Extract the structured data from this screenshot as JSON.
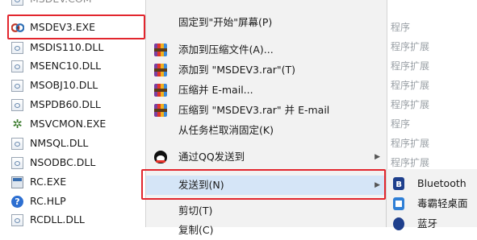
{
  "file_list": {
    "top_cut_label": "MSDEV.COM",
    "items": [
      {
        "label": "MSDEV3.EXE",
        "icon": "visual-studio-icon",
        "kind": "exe-vs"
      },
      {
        "label": "MSDIS110.DLL",
        "icon": "dll-icon",
        "kind": "dll"
      },
      {
        "label": "MSENC10.DLL",
        "icon": "dll-icon",
        "kind": "dll"
      },
      {
        "label": "MSOBJ10.DLL",
        "icon": "dll-icon",
        "kind": "dll"
      },
      {
        "label": "MSPDB60.DLL",
        "icon": "dll-icon",
        "kind": "dll"
      },
      {
        "label": "MSVCMON.EXE",
        "icon": "gear-icon",
        "kind": "gear"
      },
      {
        "label": "NMSQL.DLL",
        "icon": "dll-icon",
        "kind": "dll"
      },
      {
        "label": "NSODBC.DLL",
        "icon": "dll-icon",
        "kind": "dll"
      },
      {
        "label": "RC.EXE",
        "icon": "application-icon",
        "kind": "exe-app"
      },
      {
        "label": "RC.HLP",
        "icon": "help-icon",
        "kind": "help"
      },
      {
        "label": "RCDLL.DLL",
        "icon": "dll-icon",
        "kind": "dll"
      }
    ]
  },
  "background_column": {
    "items": [
      "程序",
      "程序扩展",
      "程序扩展",
      "程序扩展",
      "程序扩展",
      "程序",
      "程序扩展",
      "程序扩展"
    ]
  },
  "context_menu": {
    "items": [
      {
        "label": "固定到\"开始\"屏幕(P)",
        "icon": ""
      },
      {
        "label": "添加到压缩文件(A)...",
        "icon": "winrar-icon"
      },
      {
        "label": "添加到 \"MSDEV3.rar\"(T)",
        "icon": "winrar-icon"
      },
      {
        "label": "压缩并 E-mail...",
        "icon": "winrar-icon"
      },
      {
        "label": "压缩到 \"MSDEV3.rar\" 并 E-mail",
        "icon": "winrar-icon"
      },
      {
        "label": "从任务栏取消固定(K)",
        "icon": ""
      },
      {
        "label": "通过QQ发送到",
        "icon": "qq-icon",
        "submenu": true
      },
      {
        "label": "发送到(N)",
        "icon": "",
        "submenu": true,
        "highlighted": true
      },
      {
        "label": "剪切(T)",
        "icon": ""
      },
      {
        "label": "复制(C)",
        "icon": ""
      }
    ]
  },
  "send_to_submenu": {
    "items": [
      {
        "label": "Bluetooth",
        "icon": "bluetooth-icon"
      },
      {
        "label": "毒霸轻桌面",
        "icon": "desktop-app-icon"
      },
      {
        "label": "蓝牙",
        "icon": "bluetooth-icon"
      }
    ]
  },
  "colors": {
    "highlight_border": "#e2262e",
    "menu_background": "#f2f2f2",
    "menu_hover": "#d5e5f7"
  }
}
